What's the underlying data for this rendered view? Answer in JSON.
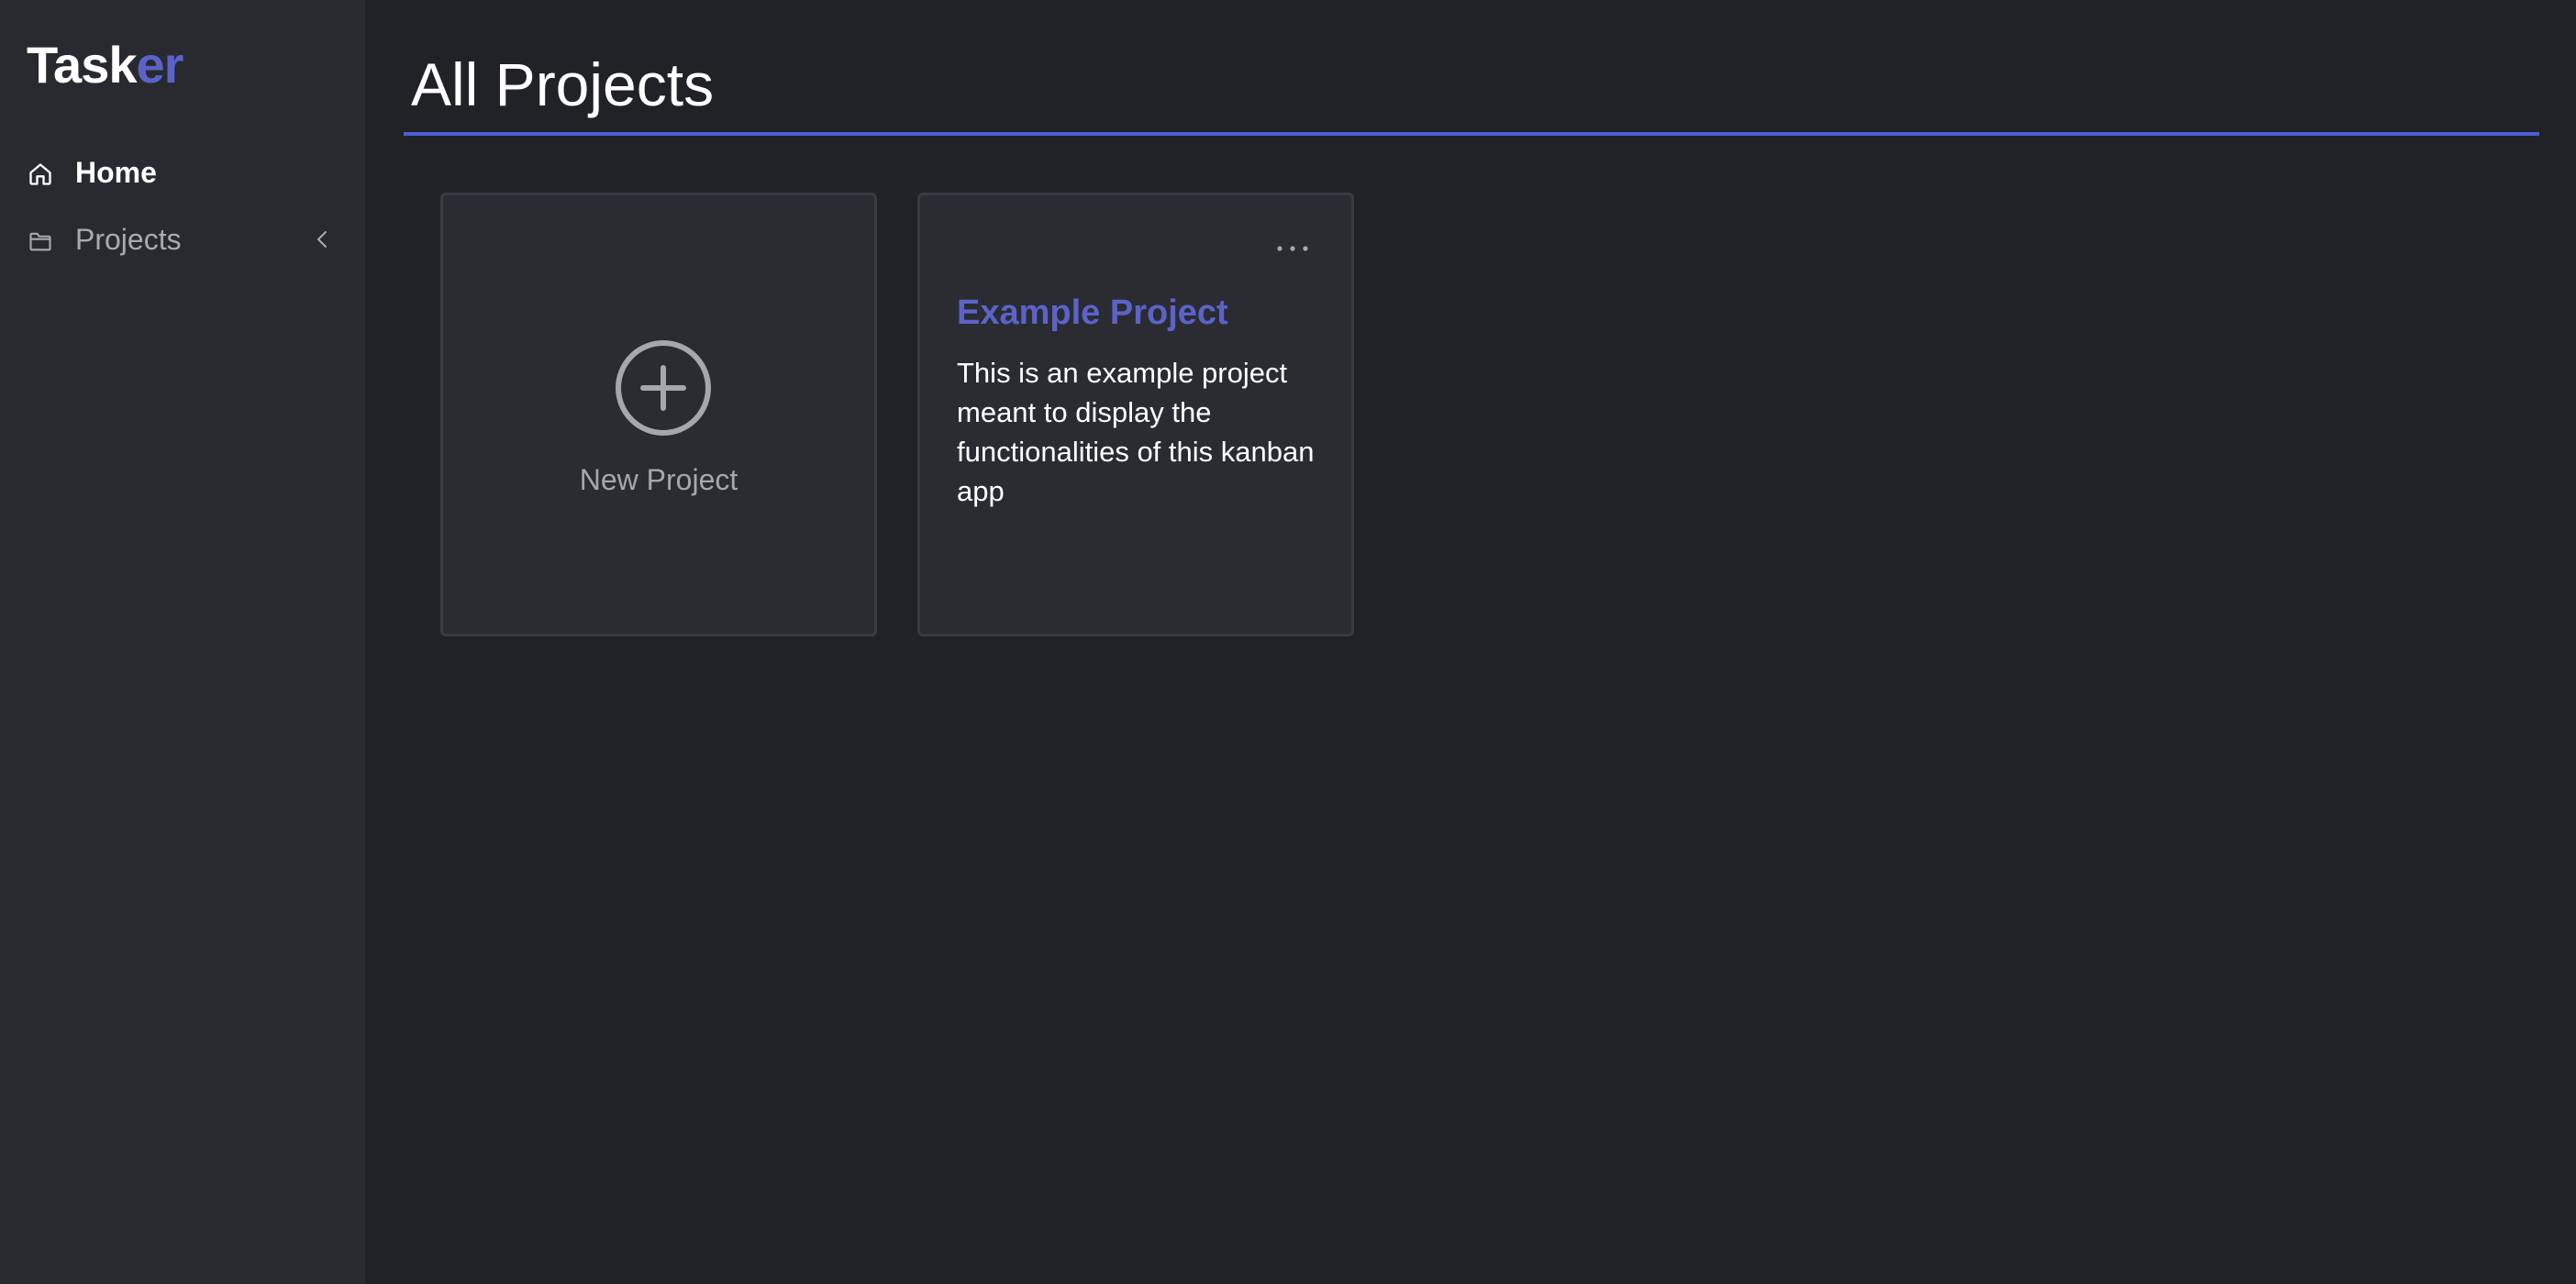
{
  "app": {
    "logo_part1": "Task",
    "logo_part2": "er",
    "accent_color": "#5b63c9",
    "rule_color": "#4a5fd6"
  },
  "sidebar": {
    "items": [
      {
        "label": "Home",
        "icon": "home-icon",
        "active": true
      },
      {
        "label": "Projects",
        "icon": "folder-icon",
        "expandable": true,
        "expand_icon": "chevron-left-icon"
      }
    ]
  },
  "main": {
    "title": "All Projects",
    "new_project": {
      "label": "New Project",
      "icon": "plus-circle-icon"
    },
    "projects": [
      {
        "title": "Example Project",
        "description": "This is an example project meant to display the functionalities of this kanban app",
        "menu_icon": "more-horizontal-icon"
      }
    ]
  }
}
